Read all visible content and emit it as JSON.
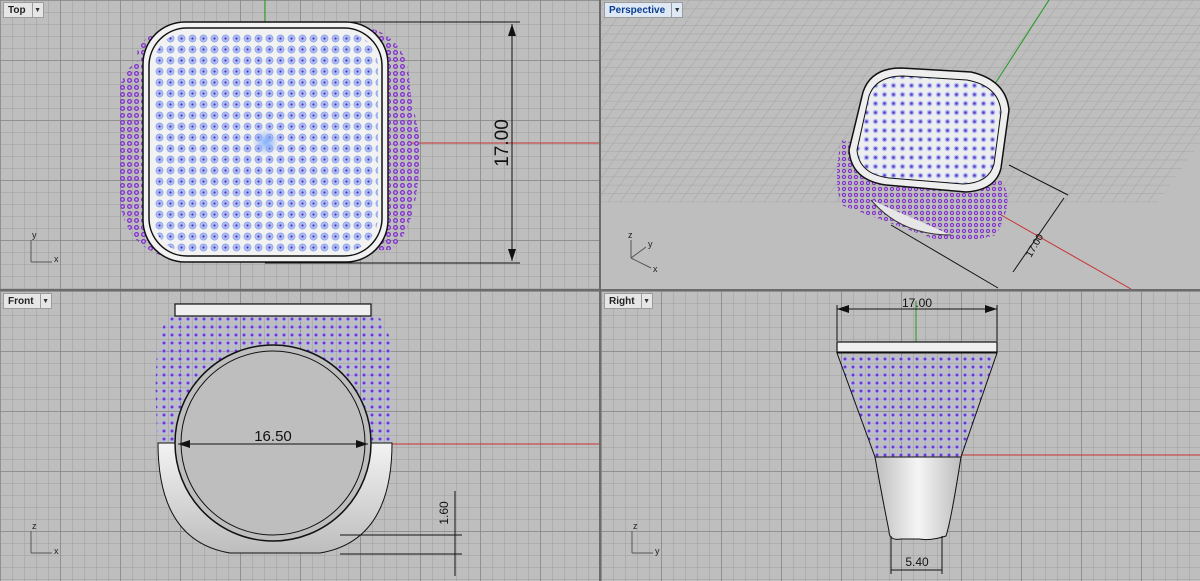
{
  "viewports": {
    "top": {
      "label": "Top",
      "dimension": "17.00"
    },
    "perspective": {
      "label": "Perspective",
      "dimension": "17.00"
    },
    "front": {
      "label": "Front",
      "width_dimension": "16.50",
      "thickness_dimension": "1.60"
    },
    "right": {
      "label": "Right",
      "top_dimension": "17.00",
      "bottom_dimension": "5.40"
    }
  },
  "axes": {
    "top": {
      "a": "x",
      "b": "y"
    },
    "perspective": {
      "a": "x",
      "b": "y",
      "c": "z"
    },
    "front": {
      "a": "x",
      "b": "z"
    },
    "right": {
      "a": "y",
      "b": "z"
    }
  },
  "icons": {
    "dropdown": "dropdown-arrow-icon",
    "axis": "axis-widget-icon"
  },
  "colors": {
    "gem_blue": "#9fb6f7",
    "gem_purple": "#8a3cc9",
    "x_axis": "#c83232",
    "y_axis": "#1f9a1f",
    "metal": "#d8d8d8"
  }
}
